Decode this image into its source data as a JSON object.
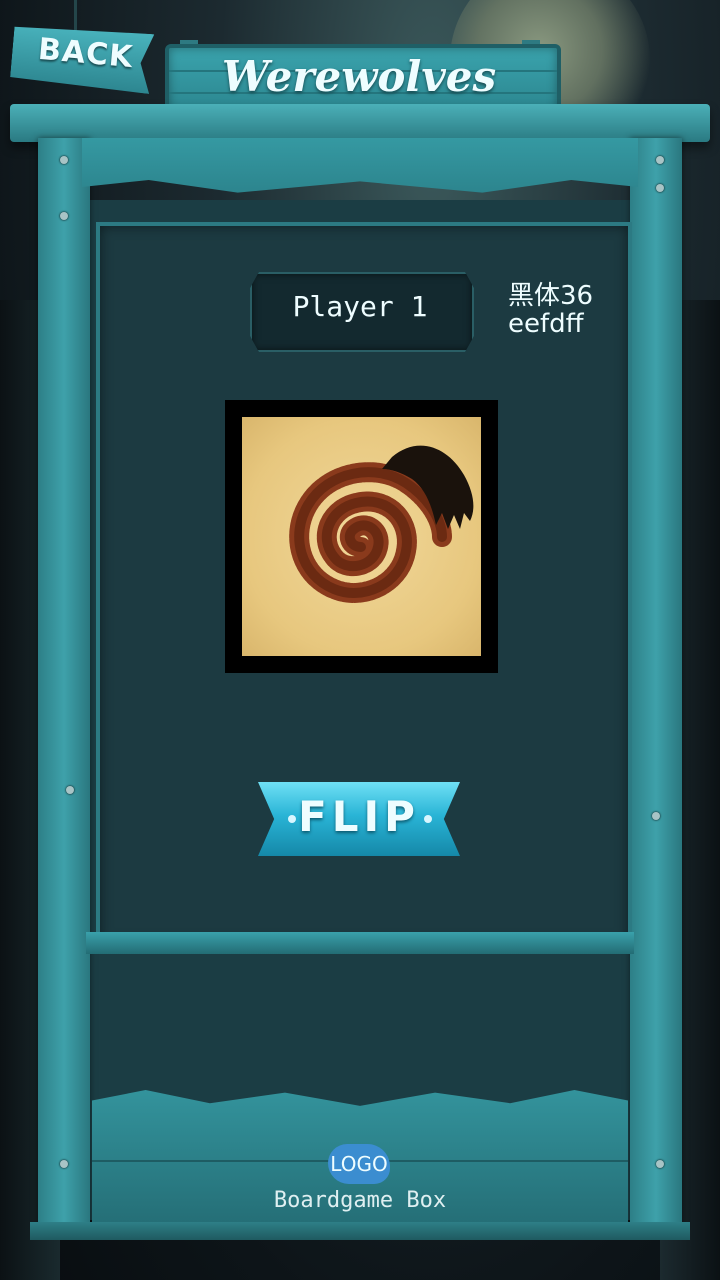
{
  "header": {
    "back_label": "BACK",
    "title": "Werewolves"
  },
  "player": {
    "label": "Player 1"
  },
  "font_note": {
    "line1": "黑体36",
    "line2": "eefdff"
  },
  "card": {
    "image_name": "werewolf-claw-spiral-card"
  },
  "actions": {
    "flip_label": "FLIP"
  },
  "footer": {
    "logo_label": "LOGO",
    "brand": "Boardgame Box"
  },
  "colors": {
    "text": "#eefdff",
    "frame": "#3aa3ad",
    "screen": "#1c3a41",
    "flip_button": "#29b4d6"
  }
}
